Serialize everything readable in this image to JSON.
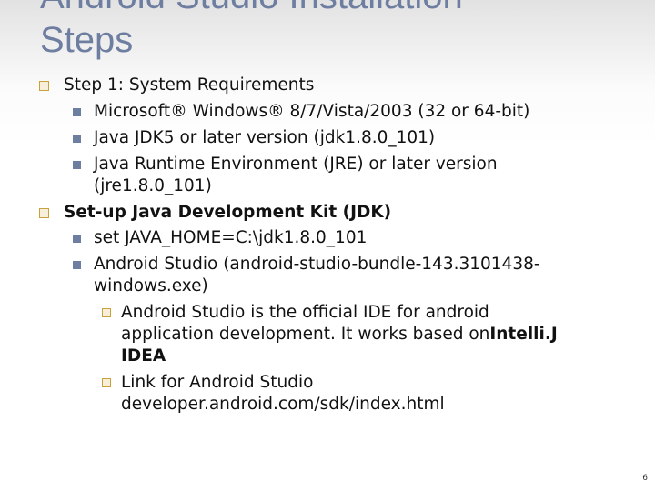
{
  "slide": {
    "title_line1": "Android Studio Installation",
    "title_line2": "Steps",
    "page_number": "6",
    "colors": {
      "title": "#6e7ea1",
      "bullet_hollow": "#c9a13a",
      "bullet_solid": "#6e7ea1"
    }
  },
  "content": {
    "step1": "Step 1: System Requirements",
    "req_windows": "Microsoft® Windows® 8/7/Vista/2003 (32 or 64-bit)",
    "req_jdk": "Java JDK5 or later version (jdk1.8.0_101)",
    "req_jre_line1": "Java Runtime Environment (JRE) or later version",
    "req_jre_line2": "(jre1.8.0_101)",
    "setup": "Set-up Java Development Kit (JDK)",
    "set_java_home": "set JAVA_HOME=C:\\jdk1.8.0_101",
    "android_studio_line1": "Android Studio (android-studio-bundle-143.3101438-",
    "android_studio_line2": "windows.exe)",
    "ide_line1": "Android Studio is the official IDE for android",
    "ide_line2_prefix": "application development. It works based on",
    "ide_line2_bold": "Intelli.J",
    "ide_line3": "IDEA",
    "link_label": "Link for Android Studio",
    "link_url": "developer.android.com/sdk/index.html"
  }
}
